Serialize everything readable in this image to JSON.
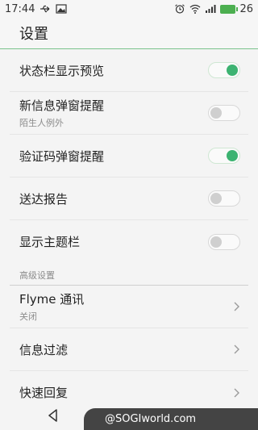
{
  "status_bar": {
    "time": "17:44",
    "battery": "26",
    "icons": [
      "usb-icon",
      "image-icon",
      "alarm-icon",
      "wifi-icon",
      "signal-icon",
      "battery-icon"
    ]
  },
  "header": {
    "title": "设置"
  },
  "settings": [
    {
      "label": "状态栏显示预览",
      "toggle": true
    },
    {
      "label": "新信息弹窗提醒",
      "sub": "陌生人例外",
      "toggle": false
    },
    {
      "label": "验证码弹窗提醒",
      "toggle": true
    },
    {
      "label": "送达报告",
      "toggle": false
    },
    {
      "label": "显示主题栏",
      "toggle": false
    }
  ],
  "advanced": {
    "header": "高级设置",
    "items": [
      {
        "label": "Flyme 通讯",
        "sub": "关闭"
      },
      {
        "label": "信息过滤"
      },
      {
        "label": "快速回复"
      }
    ]
  },
  "watermark": "@SOGIworld.com",
  "colors": {
    "accent": "#3cb371",
    "divider": "#7ac28c"
  }
}
